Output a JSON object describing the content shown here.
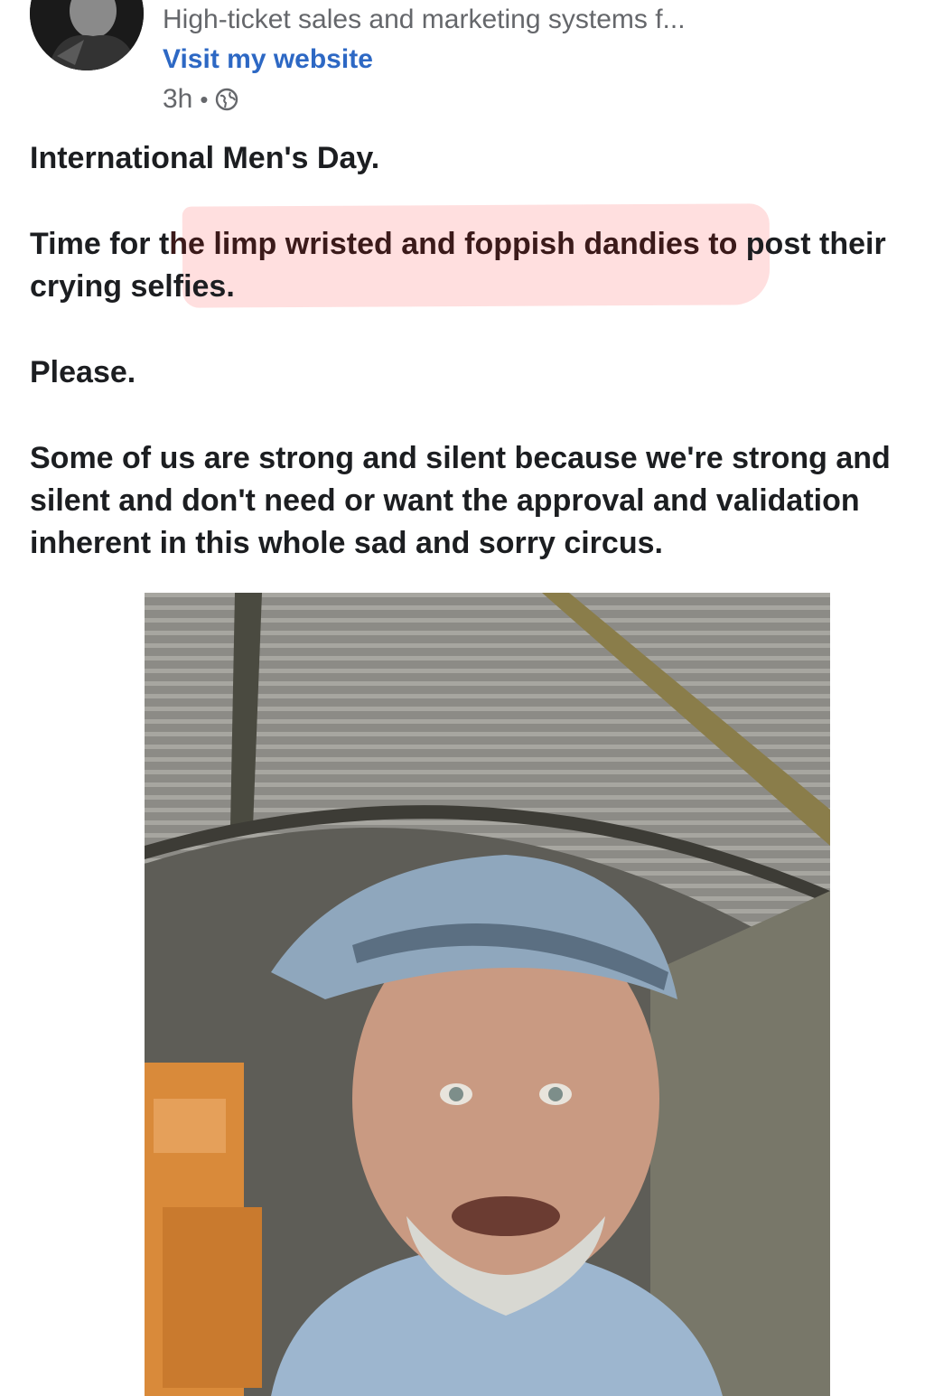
{
  "header": {
    "subtitle": "High-ticket sales and marketing systems f...",
    "visit_link": "Visit my website",
    "time": "3h",
    "separator": "•",
    "privacy_icon": "globe-icon"
  },
  "post": {
    "line1": "International Men's Day.",
    "line2_before": "Time for t",
    "line2_highlight": "he limp wristed and foppish dandies to",
    "line2_after": " post their crying selfies.",
    "line3": "Please.",
    "line4": "Some of us are strong and silent because we're strong and silent and don't need or want the approval and validation inherent in this whole sad and sorry circus."
  },
  "colors": {
    "link": "#2d68c4",
    "meta": "#65676b",
    "text": "#1c1e21",
    "highlight": "#ffd9d9"
  }
}
